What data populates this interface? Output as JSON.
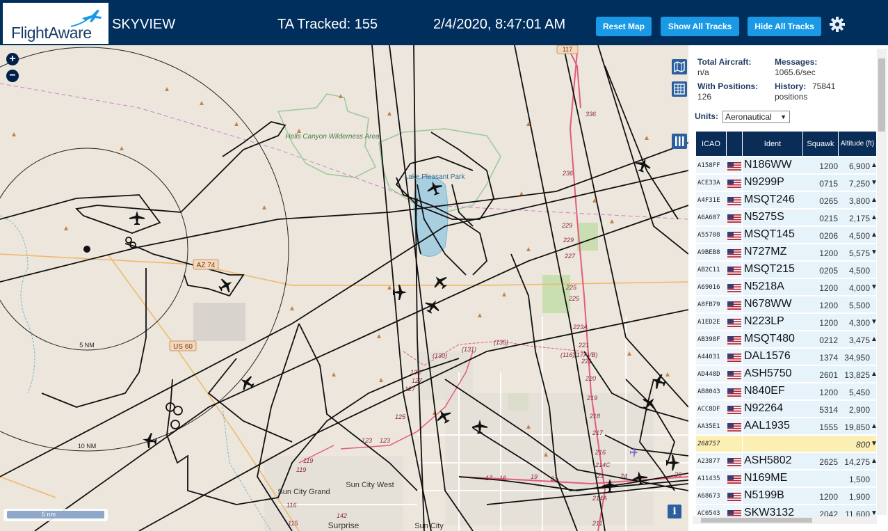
{
  "header": {
    "logo_text": "FlightAware",
    "site_name": "SKYVIEW",
    "ta_tracked": "TA Tracked: 155",
    "datetime": "2/4/2020, 8:47:01 AM",
    "buttons": {
      "reset_map": "Reset Map",
      "show_all": "Show All Tracks",
      "hide_all": "Hide All Tracks"
    },
    "settings_icon": "gear-icon",
    "colors": {
      "header_bg": "#002f5d",
      "button_bg": "#1a9ae6"
    }
  },
  "map": {
    "zoom_in": "+",
    "zoom_out": "−",
    "place_labels": {
      "hells_canyon": "Hells Canyon Wilderness Area",
      "lake_pleasant": "Lake Pleasant Park",
      "sun_city_west": "Sun City West",
      "sun_city_grand": "Sun City Grand",
      "surprise": "Surprise",
      "sun_city": "Sun City"
    },
    "road_labels": {
      "az74": "AZ 74",
      "us60": "US 60",
      "r117": "117",
      "r336": "336",
      "r229a": "229",
      "r229b": "229",
      "r227": "227",
      "r225a": "225",
      "r225b": "225",
      "r223a": "223A",
      "r221a": "221",
      "r221b": "221",
      "r219": "219",
      "r218": "218",
      "r217": "217",
      "r216": "216",
      "r214c": "214C",
      "r214a": "214A",
      "r211": "211",
      "r135": "(135)",
      "r131": "(131)",
      "r130": "(130)",
      "r128": "128",
      "r127a": "127",
      "r127b": "127",
      "r125": "125",
      "r123a": "123",
      "r123b": "123",
      "r119a": "119",
      "r119b": "119",
      "r116": "116",
      "r115": "115",
      "r142": "142",
      "r17": "17",
      "r16": "16",
      "r19": "19",
      "r21": "21",
      "r23": "23",
      "r24": "24",
      "r28": "28",
      "r236": "236",
      "r116b": "(116)",
      "r17avb": "(17AVB)"
    },
    "range_labels": {
      "ring5": "5 NM",
      "ring10": "10 NM"
    },
    "scale_label": "5 nm",
    "side_icons": [
      "map-icon",
      "grid-icon",
      "columns-icon"
    ],
    "info_label": "i"
  },
  "panel": {
    "total_aircraft_label": "Total Aircraft:",
    "total_aircraft_value": "n/a",
    "with_positions_label": "With Positions:",
    "with_positions_value": "126",
    "messages_label": "Messages:",
    "messages_value": "1065.6/sec",
    "history_label": "History:",
    "history_value": "75841",
    "history_unit": "positions",
    "units_label": "Units:",
    "units_value": "Aeronautical",
    "table": {
      "headers": [
        "ICAO",
        "",
        "Ident",
        "Squawk",
        "Altitude (ft)"
      ],
      "rows": [
        {
          "icao": "A158FF",
          "ident": "N186WW",
          "squawk": "1200",
          "alt": "6,900",
          "trend": "▲"
        },
        {
          "icao": "ACE33A",
          "ident": "N9299P",
          "squawk": "0715",
          "alt": "7,250",
          "trend": "▼"
        },
        {
          "icao": "A4F31E",
          "ident": "MSQT246",
          "squawk": "0265",
          "alt": "3,800",
          "trend": "▲"
        },
        {
          "icao": "A6A607",
          "ident": "N5275S",
          "squawk": "0215",
          "alt": "2,175",
          "trend": "▲"
        },
        {
          "icao": "A55708",
          "ident": "MSQT145",
          "squawk": "0206",
          "alt": "4,500",
          "trend": "▲"
        },
        {
          "icao": "A9BEB8",
          "ident": "N727MZ",
          "squawk": "1200",
          "alt": "5,575",
          "trend": "▼"
        },
        {
          "icao": "AB2C11",
          "ident": "MSQT215",
          "squawk": "0205",
          "alt": "4,500",
          "trend": ""
        },
        {
          "icao": "A69016",
          "ident": "N5218A",
          "squawk": "1200",
          "alt": "4,000",
          "trend": "▼"
        },
        {
          "icao": "A8FB79",
          "ident": "N678WW",
          "squawk": "1200",
          "alt": "5,500",
          "trend": ""
        },
        {
          "icao": "A1ED2E",
          "ident": "N223LP",
          "squawk": "1200",
          "alt": "4,300",
          "trend": "▼"
        },
        {
          "icao": "AB398F",
          "ident": "MSQT480",
          "squawk": "0212",
          "alt": "3,475",
          "trend": "▲"
        },
        {
          "icao": "A44031",
          "ident": "DAL1576",
          "squawk": "1374",
          "alt": "34,950",
          "trend": ""
        },
        {
          "icao": "AD448D",
          "ident": "ASH5750",
          "squawk": "2601",
          "alt": "13,825",
          "trend": "▲"
        },
        {
          "icao": "AB8043",
          "ident": "N840EF",
          "squawk": "1200",
          "alt": "5,450",
          "trend": ""
        },
        {
          "icao": "ACC8DF",
          "ident": "N92264",
          "squawk": "5314",
          "alt": "2,900",
          "trend": ""
        },
        {
          "icao": "AA35E1",
          "ident": "AAL1935",
          "squawk": "1555",
          "alt": "19,850",
          "trend": "▲"
        },
        {
          "icao": "268757",
          "ident": "",
          "squawk": "",
          "alt": "800",
          "trend": "▼",
          "highlight": true
        },
        {
          "icao": "A23877",
          "ident": "ASH5802",
          "squawk": "2625",
          "alt": "14,275",
          "trend": "▲"
        },
        {
          "icao": "A11435",
          "ident": "N169ME",
          "squawk": "",
          "alt": "1,500",
          "trend": ""
        },
        {
          "icao": "A68673",
          "ident": "N5199B",
          "squawk": "1200",
          "alt": "1,900",
          "trend": ""
        },
        {
          "icao": "AC0543",
          "ident": "SKW3132",
          "squawk": "2042",
          "alt": "11,600",
          "trend": "▼"
        }
      ]
    }
  }
}
